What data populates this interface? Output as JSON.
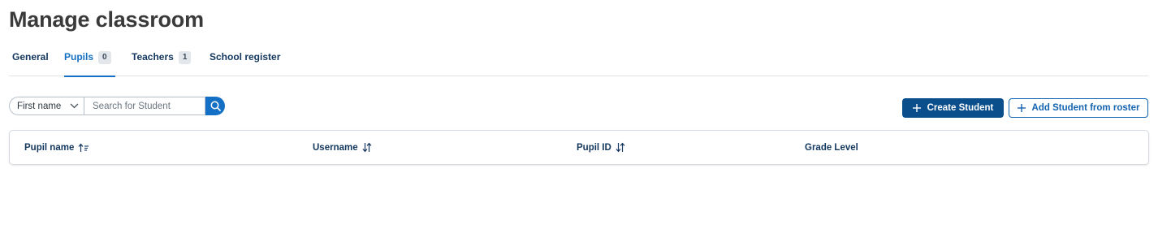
{
  "page": {
    "title": "Manage classroom"
  },
  "tabs": [
    {
      "label": "General",
      "count": null,
      "active": false
    },
    {
      "label": "Pupils",
      "count": "0",
      "active": true
    },
    {
      "label": "Teachers",
      "count": "1",
      "active": false
    },
    {
      "label": "School register",
      "count": null,
      "active": false
    }
  ],
  "search": {
    "filter_selected": "First name",
    "placeholder": "Search for Student",
    "value": "",
    "button_icon": "search-icon"
  },
  "actions": {
    "create_label": "Create Student",
    "add_roster_label": "Add Student from roster",
    "icon": "plus-icon"
  },
  "table": {
    "columns": [
      {
        "label": "Pupil name",
        "sort_icon": "sort-ascending-icon"
      },
      {
        "label": "Username",
        "sort_icon": "sort-icon"
      },
      {
        "label": "Pupil ID",
        "sort_icon": "sort-icon"
      },
      {
        "label": "Grade Level",
        "sort_icon": null
      }
    ],
    "rows": []
  },
  "colors": {
    "accent": "#1470c4",
    "primary_button": "#0a4e8c",
    "heading_text": "#13375e",
    "title_text": "#3a3a3a"
  }
}
